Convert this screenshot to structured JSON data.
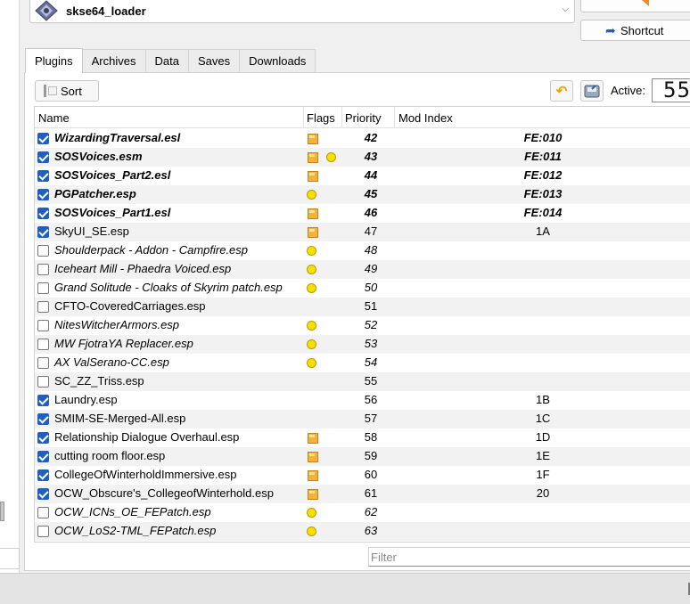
{
  "toolbar": {
    "executable": "skse64_loader",
    "shortcut_label": "Shortcut",
    "active_label": "Active:",
    "active_count": "55",
    "sort_label": "Sort"
  },
  "tabs": [
    {
      "label": "Plugins",
      "active": true
    },
    {
      "label": "Archives",
      "active": false
    },
    {
      "label": "Data",
      "active": false
    },
    {
      "label": "Saves",
      "active": false
    },
    {
      "label": "Downloads",
      "active": false
    }
  ],
  "table": {
    "columns": {
      "name": "Name",
      "flags": "Flags",
      "priority": "Priority",
      "mod_index": "Mod Index"
    },
    "rows": [
      {
        "name": "WizardingTraversal.esl",
        "checked": true,
        "style": "master",
        "flags": [
          "box"
        ],
        "priority": "42",
        "mod_index": "FE:010"
      },
      {
        "name": "SOSVoices.esm",
        "checked": true,
        "style": "master",
        "flags": [
          "box",
          "dot"
        ],
        "priority": "43",
        "mod_index": "FE:011"
      },
      {
        "name": "SOSVoices_Part2.esl",
        "checked": true,
        "style": "master",
        "flags": [
          "box"
        ],
        "priority": "44",
        "mod_index": "FE:012"
      },
      {
        "name": "PGPatcher.esp",
        "checked": true,
        "style": "master",
        "flags": [
          "dot"
        ],
        "priority": "45",
        "mod_index": "FE:013"
      },
      {
        "name": "SOSVoices_Part1.esl",
        "checked": true,
        "style": "master",
        "flags": [
          "box"
        ],
        "priority": "46",
        "mod_index": "FE:014"
      },
      {
        "name": "SkyUI_SE.esp",
        "checked": true,
        "style": "normal",
        "flags": [
          "box"
        ],
        "priority": "47",
        "mod_index": "1A"
      },
      {
        "name": "Shoulderpack - Addon - Campfire.esp",
        "checked": false,
        "style": "light",
        "flags": [
          "dot"
        ],
        "priority": "48",
        "mod_index": ""
      },
      {
        "name": "Iceheart Mill - Phaedra Voiced.esp",
        "checked": false,
        "style": "light",
        "flags": [
          "dot"
        ],
        "priority": "49",
        "mod_index": ""
      },
      {
        "name": "Grand Solitude - Cloaks of Skyrim patch.esp",
        "checked": false,
        "style": "light",
        "flags": [
          "dot"
        ],
        "priority": "50",
        "mod_index": ""
      },
      {
        "name": "CFTO-CoveredCarriages.esp",
        "checked": false,
        "style": "normal",
        "flags": [],
        "priority": "51",
        "mod_index": ""
      },
      {
        "name": "NitesWitcherArmors.esp",
        "checked": false,
        "style": "light",
        "flags": [
          "dot"
        ],
        "priority": "52",
        "mod_index": ""
      },
      {
        "name": "MW FjotraYA Replacer.esp",
        "checked": false,
        "style": "light",
        "flags": [
          "dot"
        ],
        "priority": "53",
        "mod_index": ""
      },
      {
        "name": "AX ValSerano-CC.esp",
        "checked": false,
        "style": "light",
        "flags": [
          "dot"
        ],
        "priority": "54",
        "mod_index": ""
      },
      {
        "name": "SC_ZZ_Triss.esp",
        "checked": false,
        "style": "normal",
        "flags": [],
        "priority": "55",
        "mod_index": ""
      },
      {
        "name": "Laundry.esp",
        "checked": true,
        "style": "normal",
        "flags": [],
        "priority": "56",
        "mod_index": "1B"
      },
      {
        "name": "SMIM-SE-Merged-All.esp",
        "checked": true,
        "style": "normal",
        "flags": [],
        "priority": "57",
        "mod_index": "1C"
      },
      {
        "name": "Relationship Dialogue Overhaul.esp",
        "checked": true,
        "style": "normal",
        "flags": [
          "box"
        ],
        "priority": "58",
        "mod_index": "1D"
      },
      {
        "name": "cutting room floor.esp",
        "checked": true,
        "style": "normal",
        "flags": [
          "box"
        ],
        "priority": "59",
        "mod_index": "1E"
      },
      {
        "name": "CollegeOfWinterholdImmersive.esp",
        "checked": true,
        "style": "normal",
        "flags": [
          "box"
        ],
        "priority": "60",
        "mod_index": "1F"
      },
      {
        "name": "OCW_Obscure's_CollegeofWinterhold.esp",
        "checked": true,
        "style": "normal",
        "flags": [
          "box"
        ],
        "priority": "61",
        "mod_index": "20"
      },
      {
        "name": "OCW_ICNs_OE_FEPatch.esp",
        "checked": false,
        "style": "light",
        "flags": [
          "dot"
        ],
        "priority": "62",
        "mod_index": ""
      },
      {
        "name": "OCW_LoS2-TML_FEPatch.esp",
        "checked": false,
        "style": "light",
        "flags": [
          "dot"
        ],
        "priority": "63",
        "mod_index": ""
      }
    ]
  },
  "filter": {
    "placeholder": "Filter"
  },
  "colors": {
    "checkbox": "#1f5fbf",
    "row_alt": "#f2f2f2",
    "flag_dot": "#f7df00",
    "flag_box": "#f3b23a",
    "accent_orange": "#f08a2c"
  },
  "icons": {
    "executable": "skse-icon",
    "shortcut": "shortcut-arrow-icon",
    "undo": "undo-icon",
    "save": "save-icon",
    "sort": "sort-icon"
  }
}
